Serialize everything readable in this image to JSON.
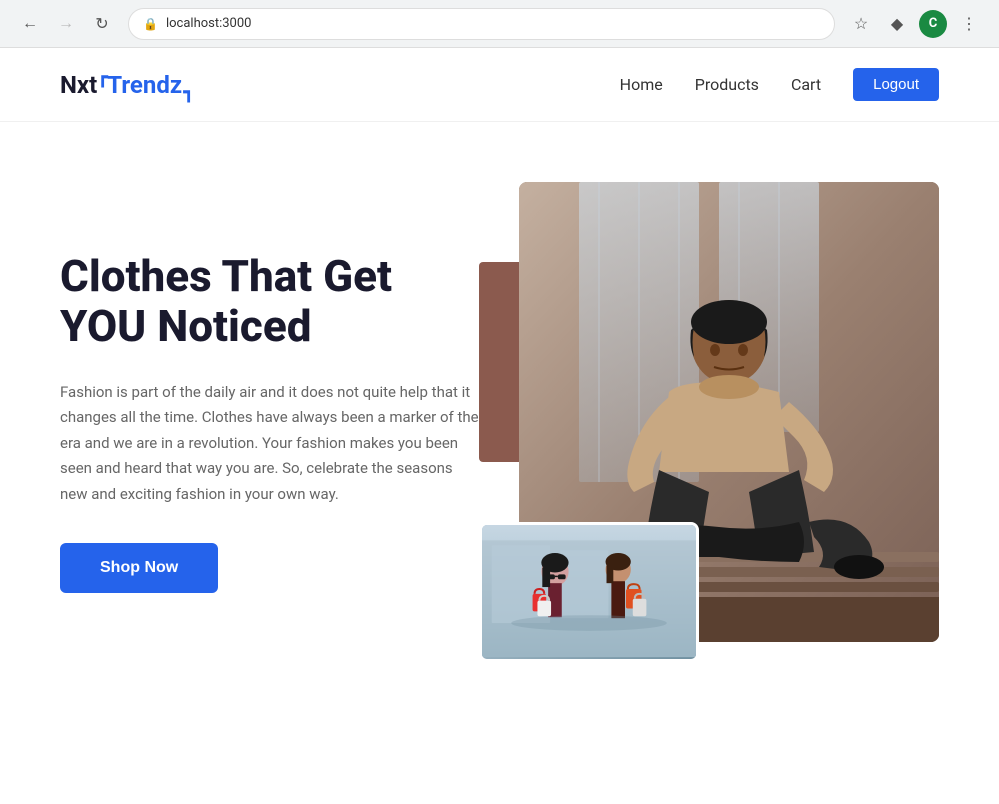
{
  "browser": {
    "url": "localhost:3000",
    "avatar_label": "C",
    "back_disabled": false,
    "forward_disabled": true
  },
  "navbar": {
    "logo_nxt": "Nxt",
    "logo_trendz": "Trendz",
    "links": [
      {
        "label": "Home",
        "id": "home"
      },
      {
        "label": "Products",
        "id": "products"
      },
      {
        "label": "Cart",
        "id": "cart"
      }
    ],
    "logout_label": "Logout"
  },
  "hero": {
    "title_line1": "Clothes That Get",
    "title_line2": "YOU Noticed",
    "description": "Fashion is part of the daily air and it does not quite help that it changes all the time. Clothes have always been a marker of the era and we are in a revolution. Your fashion makes you been seen and heard that way you are. So, celebrate the seasons new and exciting fashion in your own way.",
    "shop_now_label": "Shop Now"
  },
  "colors": {
    "primary_blue": "#2563eb",
    "dark": "#1a1a2e",
    "accent_brown": "#8b5a4e",
    "text_gray": "#666666"
  }
}
